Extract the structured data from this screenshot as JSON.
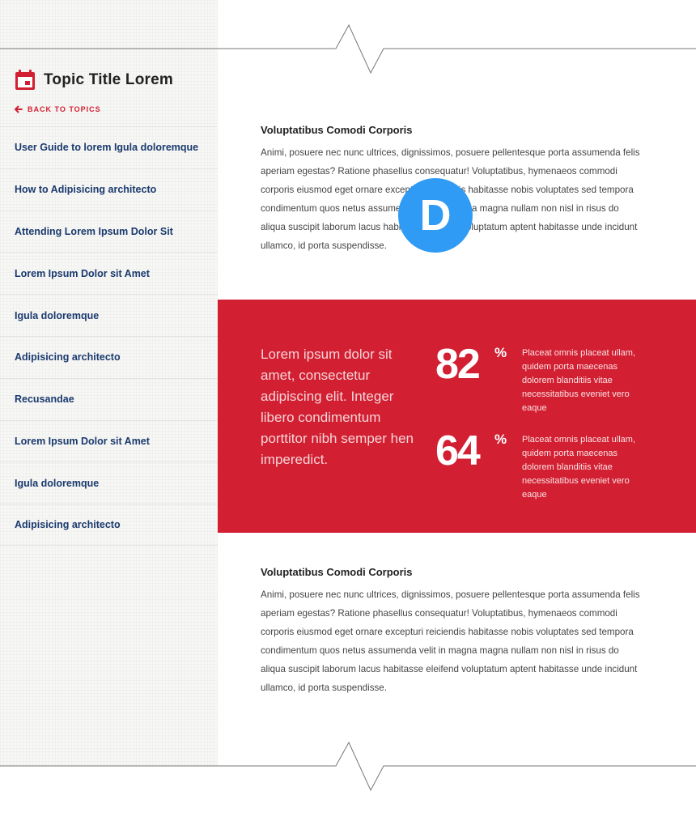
{
  "sidebar": {
    "topic_title": "Topic Title Lorem",
    "topic_icon": "calendar-icon",
    "back_link": "BACK TO TOPICS",
    "back_icon": "arrow-left-icon",
    "items": [
      {
        "label": "User Guide to lorem Igula doloremque"
      },
      {
        "label": "How to Adipisicing architecto"
      },
      {
        "label": "Attending Lorem Ipsum Dolor Sit"
      },
      {
        "label": "Lorem Ipsum Dolor sit Amet"
      },
      {
        "label": "Igula doloremque"
      },
      {
        "label": "Adipisicing architecto"
      },
      {
        "label": "Recusandae"
      },
      {
        "label": "Lorem Ipsum Dolor sit Amet"
      },
      {
        "label": "Igula doloremque"
      },
      {
        "label": "Adipisicing architecto"
      }
    ]
  },
  "articles": [
    {
      "title": "Voluptatibus Comodi Corporis",
      "body": "Animi, posuere nec nunc ultrices, dignissimos, posuere pellentesque porta assumenda felis aperiam egestas? Ratione phasellus consequatur! Voluptatibus, hymenaeos commodi corporis eiusmod eget ornare excepturi reiciendis habitasse nobis voluptates sed tempora condimentum quos netus assumenda velit in magna magna nullam non nisl in risus do aliqua suscipit laborum lacus habitasse eleifend voluptatum aptent habitasse unde incidunt ullamco, id porta suspendisse."
    },
    {
      "title": "Voluptatibus Comodi Corporis",
      "body": "Animi, posuere nec nunc ultrices, dignissimos, posuere pellentesque porta assumenda felis aperiam egestas? Ratione phasellus consequatur! Voluptatibus, hymenaeos commodi corporis eiusmod eget ornare excepturi reiciendis habitasse nobis voluptates sed tempora condimentum quos netus assumenda velit in magna magna nullam non nisl in risus do aliqua suscipit laborum lacus habitasse eleifend voluptatum aptent habitasse unde incidunt ullamco, id porta suspendisse."
    }
  ],
  "stats_band": {
    "lead": "Lorem ipsum dolor sit amet, consectetur adipiscing elit. Integer libero condimentum porttitor nibh semper hen imperedict.",
    "stats": [
      {
        "value": "82",
        "unit": "%",
        "description": "Placeat omnis placeat ullam, quidem porta maecenas dolorem blanditiis vitae necessitatibus eveniet vero eaque"
      },
      {
        "value": "64",
        "unit": "%",
        "description": "Placeat omnis placeat ullam, quidem porta maecenas dolorem blanditiis vitae necessitatibus eveniet vero eaque"
      }
    ]
  },
  "badge": {
    "letter": "D"
  },
  "colors": {
    "accent_red": "#d21f32",
    "nav_blue": "#1a3a6e",
    "badge_blue": "#2f9bf4",
    "sidebar_bg": "#f7f7f5"
  }
}
